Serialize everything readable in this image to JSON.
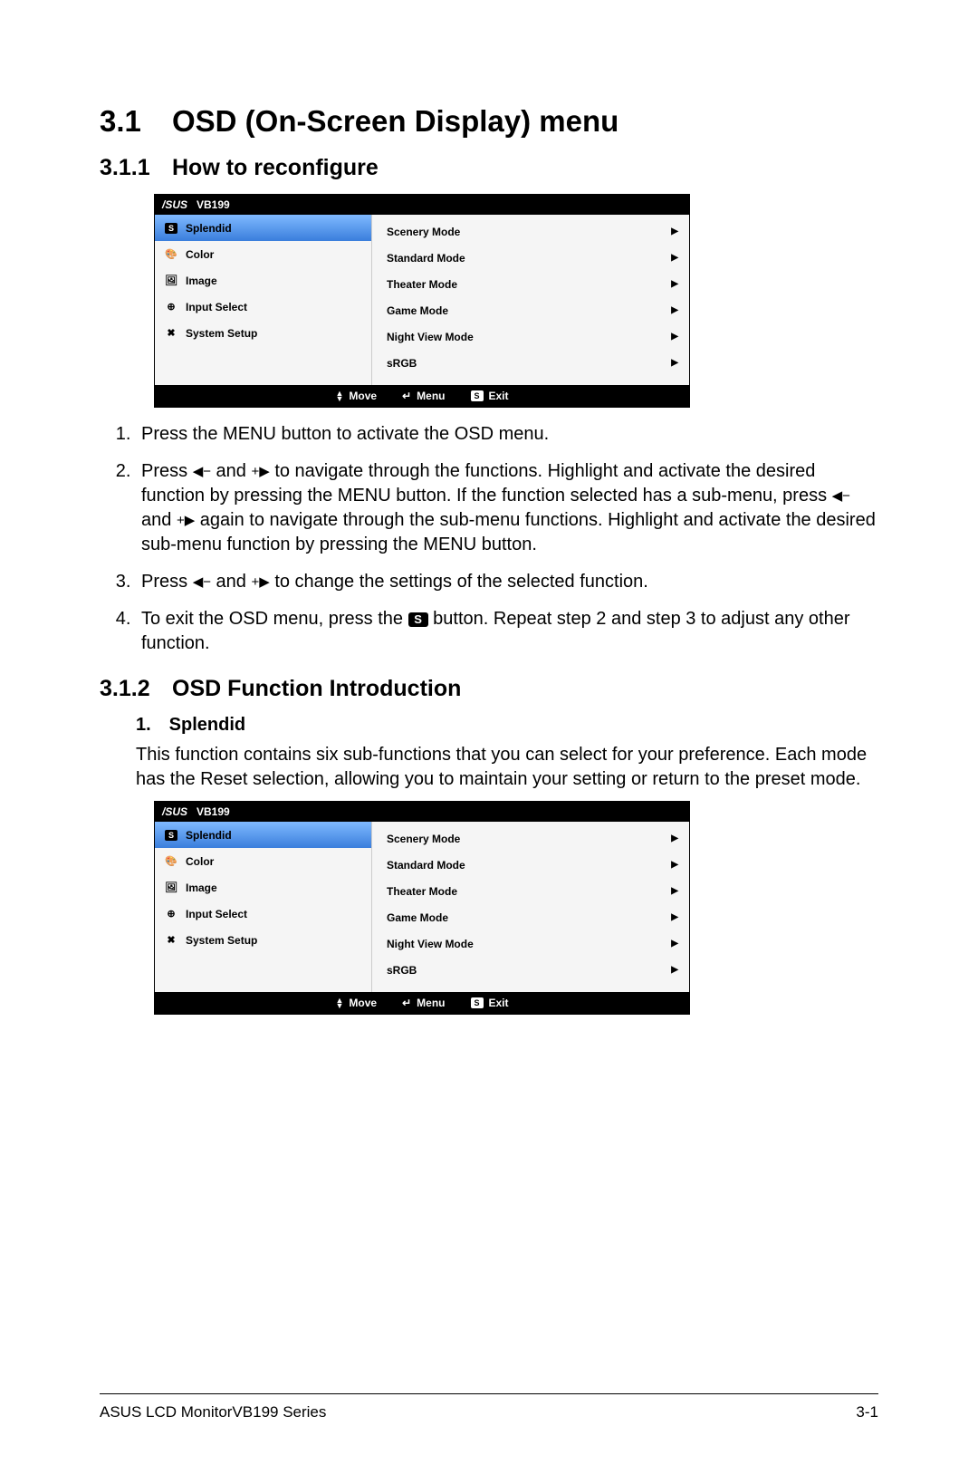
{
  "section": {
    "number": "3.1",
    "title": "OSD (On-Screen Display) menu"
  },
  "sub311": {
    "number": "3.1.1",
    "title": "How to reconfigure"
  },
  "sub312": {
    "number": "3.1.2",
    "title": "OSD Function Introduction"
  },
  "osd": {
    "brand": "/SUS",
    "model": "VB199",
    "left_items": [
      {
        "label": "Splendid",
        "icon": "s-badge",
        "selected": true
      },
      {
        "label": "Color",
        "icon": "palette",
        "selected": false
      },
      {
        "label": "Image",
        "icon": "image",
        "selected": false
      },
      {
        "label": "Input Select",
        "icon": "input",
        "selected": false
      },
      {
        "label": "System Setup",
        "icon": "tools",
        "selected": false
      }
    ],
    "right_items": [
      "Scenery Mode",
      "Standard Mode",
      "Theater Mode",
      "Game Mode",
      "Night View Mode",
      "sRGB"
    ],
    "footer": {
      "move": "Move",
      "menu": "Menu",
      "exit": "Exit"
    }
  },
  "steps": {
    "s1": "Press the MENU button to activate the OSD menu.",
    "s2a": "Press ",
    "s2b": " and ",
    "s2c": " to navigate through the functions. Highlight and activate the desired function by pressing the MENU button. If the function selected has a sub-menu, press ",
    "s2d": " and ",
    "s2e": " again to navigate through the sub-menu functions. Highlight and activate the desired sub-menu function by pressing the MENU button.",
    "s3a": "Press ",
    "s3b": " and ",
    "s3c": " to change the settings of the selected function.",
    "s4a": "To exit the OSD menu, press the ",
    "s4b": " button. Repeat step 2 and step 3 to adjust any other function."
  },
  "splendid": {
    "heading": "1. Splendid",
    "para": "This function contains six sub-functions that you can select for your preference. Each mode has the Reset selection, allowing you to maintain your setting or return to the preset mode."
  },
  "footer": {
    "left": "ASUS LCD MonitorVB199 Series",
    "right": "3-1"
  },
  "glyphs": {
    "left_minus": "◀−",
    "plus_right": "+▶",
    "s_label": "S",
    "updown": "▲▼",
    "menu_icon": "↲",
    "tri_right": "▶"
  }
}
